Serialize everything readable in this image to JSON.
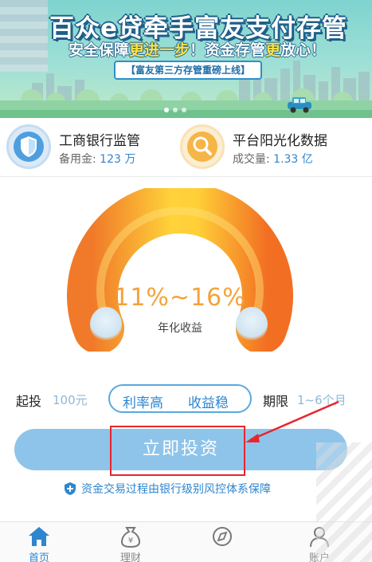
{
  "banner": {
    "title": "百众e贷牵手富友支付存管",
    "subtitle_parts": [
      "安全保障",
      "更进一步",
      "！资金存管",
      "更",
      "放心！"
    ],
    "tag": "【富友第三方存管重磅上线】",
    "slide_count": 3,
    "active_slide": 0
  },
  "features": [
    {
      "title": "工商银行监管",
      "label": "备用金:",
      "value": "123 万",
      "icon": "shield-icon"
    },
    {
      "title": "平台阳光化数据",
      "label": "成交量:",
      "value": "1.33 亿",
      "icon": "magnifier-icon"
    }
  ],
  "gauge": {
    "rate": "11%~16%",
    "label": "年化收益"
  },
  "terms": {
    "min_label": "起投",
    "min_value": "100元",
    "tag_high_rate": "利率高",
    "tag_stable": "收益稳",
    "period_label": "期限",
    "period_value": "1~6个月"
  },
  "cta": {
    "label": "立即投资"
  },
  "notice": "资金交易过程由银行级别风控体系保障",
  "tabbar": [
    {
      "label": "首页",
      "icon": "home-icon",
      "active": true
    },
    {
      "label": "理财",
      "icon": "money-bag-icon",
      "active": false
    },
    {
      "label": "",
      "icon": "compass-icon",
      "active": false
    },
    {
      "label": "账户",
      "icon": "user-icon",
      "active": false
    }
  ],
  "colors": {
    "accent": "#2e86cf",
    "cta": "#8ec4ea",
    "highlight": "#e8262c",
    "rate": "#f3a33a"
  }
}
